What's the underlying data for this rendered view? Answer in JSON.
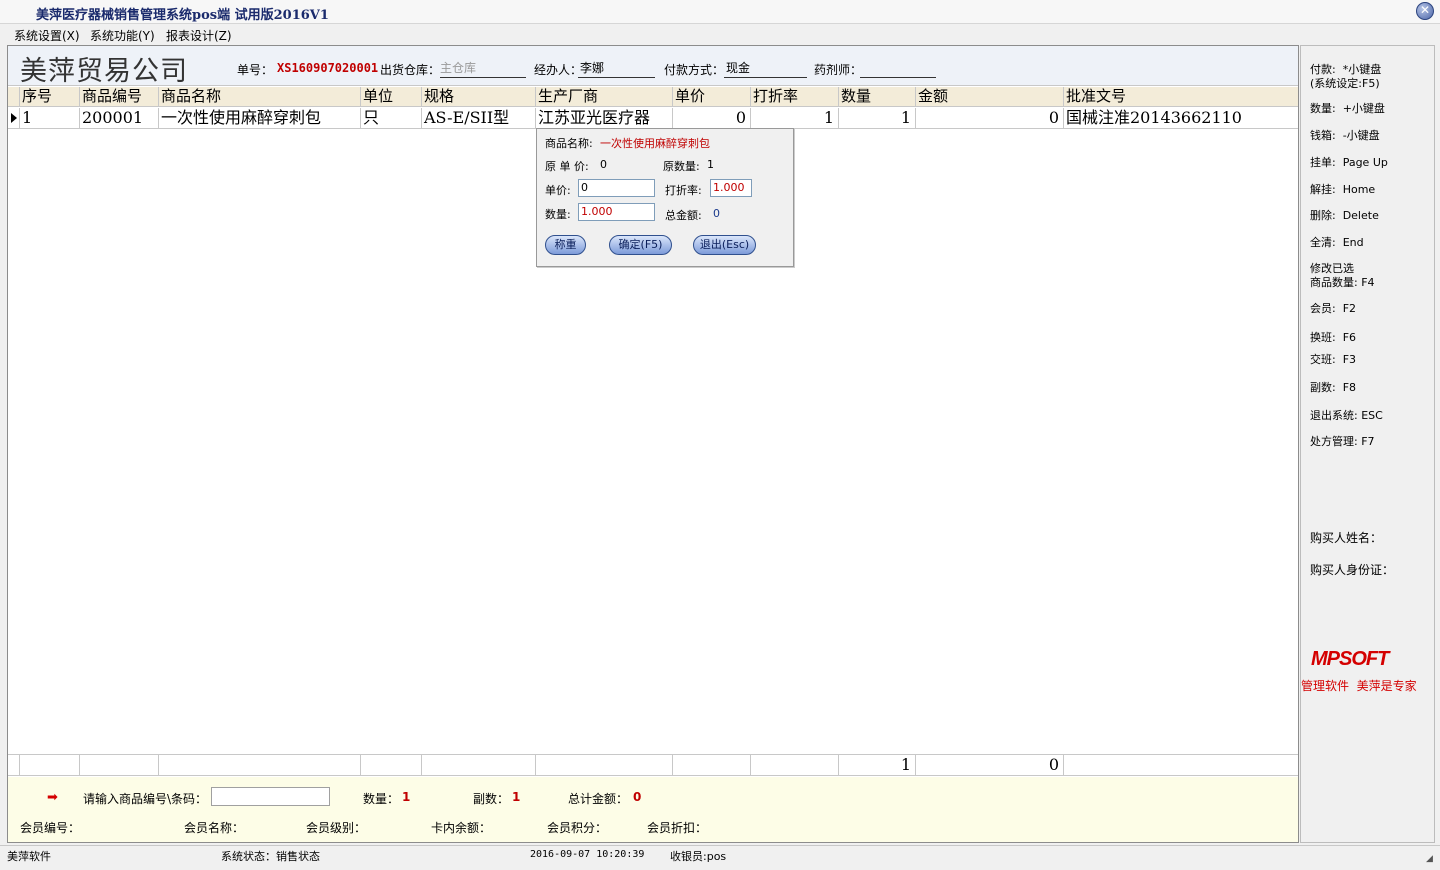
{
  "window": {
    "title": "美萍医疗器械销售管理系统pos端  试用版2016V1",
    "close_icon": "close-icon"
  },
  "menu": {
    "items": [
      "系统设置(X)",
      "系统功能(Y)",
      "报表设计(Z)"
    ]
  },
  "header": {
    "company": "美萍贸易公司",
    "order_no_label": "单号：",
    "order_no": "XS160907020001",
    "warehouse_label": "出货仓库：",
    "warehouse_placeholder": "主仓库",
    "handler_label": "经办人：",
    "handler": "李娜",
    "payment_label": "付款方式：",
    "payment": "现金",
    "pharmacist_label": "药剂师：",
    "pharmacist": ""
  },
  "table": {
    "columns": [
      "序号",
      "商品编号",
      "商品名称",
      "单位",
      "规格",
      "生产厂商",
      "单价",
      "打折率",
      "数量",
      "金额",
      "批准文号"
    ],
    "rows": [
      [
        "1",
        "200001",
        "一次性使用麻醉穿刺包",
        "只",
        "AS-E/SII型",
        "江苏亚光医疗器",
        "0",
        "1",
        "1",
        "0",
        "国械注准20143662110"
      ]
    ],
    "totals": {
      "quantity": "1",
      "amount": "0"
    }
  },
  "popup": {
    "name_label": "商品名称:",
    "name_value": "一次性使用麻醉穿刺包",
    "orig_price_label": "原 单 价:",
    "orig_price": "0",
    "orig_qty_label": "原数量:",
    "orig_qty": "1",
    "price_label": "单价:",
    "price_value": "0",
    "discount_label": "打折率:",
    "discount_value": "1.000",
    "qty_label": "数量:",
    "qty_value": "1.000",
    "total_label": "总金额:",
    "total_value": "0",
    "btn_weigh": "称重",
    "btn_ok": "确定(F5)",
    "btn_exit": "退出(Esc)"
  },
  "info": {
    "input_label": "请输入商品编号\\条码：",
    "qty_label": "数量：",
    "qty": "1",
    "copies_label": "副数：",
    "copies": "1",
    "total_label": "总计金额：",
    "total": "0",
    "member_no": "会员编号：",
    "member_name": "会员名称：",
    "member_level": "会员级别：",
    "card_balance": "卡内余额：",
    "member_points": "会员积分：",
    "member_discount": "会员折扣："
  },
  "shortcuts": {
    "pay": "付款:  *小键盘\n(系统设定:F5)",
    "qty": "数量:  +小键盘",
    "cashbox": "钱箱:  -小键盘",
    "hold": "挂单:  Page Up",
    "unhold": "解挂:  Home",
    "delete": "删除:  Delete",
    "clear": "全清:  End",
    "modify": "修改已选\n商品数量: F4",
    "member": "会员:  F2",
    "shift": "换班:  F6",
    "handover": "交班:  F3",
    "copies": "副数:  F8",
    "exit": "退出系统: ESC",
    "prescription": "处方管理: F7",
    "buyer_name": "购买人姓名：",
    "buyer_id": "购买人身份证："
  },
  "brand": {
    "logo": "MPSOFT",
    "slogan": "管理软件  美萍是专家",
    "logo_color": "#d40000"
  },
  "statusbar": {
    "app": "美萍软件",
    "status": "系统状态：销售状态",
    "datetime": "2016-09-07 10:20:39",
    "cashier": "收银员:pos"
  }
}
